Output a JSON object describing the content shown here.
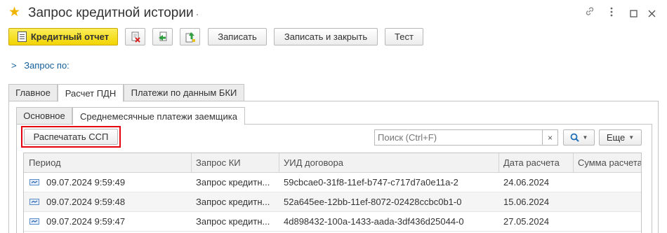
{
  "window": {
    "title": "Запрос кредитной истории"
  },
  "toolbar": {
    "credit_report_label": "Кредитный отчет",
    "save_label": "Записать",
    "save_close_label": "Записать и закрыть",
    "test_label": "Тест"
  },
  "request_section": {
    "label": "Запрос по:"
  },
  "main_tabs": [
    "Главное",
    "Расчет ПДН",
    "Платежи по данным БКИ"
  ],
  "sub_tabs": [
    "Основное",
    "Среднемесячные платежи заемщика"
  ],
  "grid_toolbar": {
    "print_label": "Распечатать ССП",
    "search_placeholder": "Поиск (Ctrl+F)",
    "clear_glyph": "×",
    "more_label": "Еще"
  },
  "table": {
    "columns": [
      "Период",
      "Запрос КИ",
      "УИД договора",
      "Дата расчета",
      "Сумма расчета"
    ],
    "rows": [
      {
        "period": "09.07.2024 9:59:49",
        "request": "Запрос кредитн...",
        "uid": "59cbcae0-31f8-11ef-b747-c717d7a0e11a-2",
        "calc_date": "24.06.2024",
        "sum": ""
      },
      {
        "period": "09.07.2024 9:59:48",
        "request": "Запрос кредитн...",
        "uid": "52a645ee-12bb-11ef-8072-02428ccbc0b1-0",
        "calc_date": "15.06.2024",
        "sum": ""
      },
      {
        "period": "09.07.2024 9:59:47",
        "request": "Запрос кредитн...",
        "uid": "4d898432-100a-1433-aada-3df436d25044-0",
        "calc_date": "27.05.2024",
        "sum": ""
      }
    ]
  },
  "icons": {
    "favorite": "star-icon",
    "link": "link-icon",
    "menu": "more-vertical-icon",
    "maximize": "maximize-icon",
    "close": "close-icon"
  },
  "colors": {
    "accent": "#f2d400",
    "highlight": "#e3000f",
    "link": "#14609e"
  }
}
